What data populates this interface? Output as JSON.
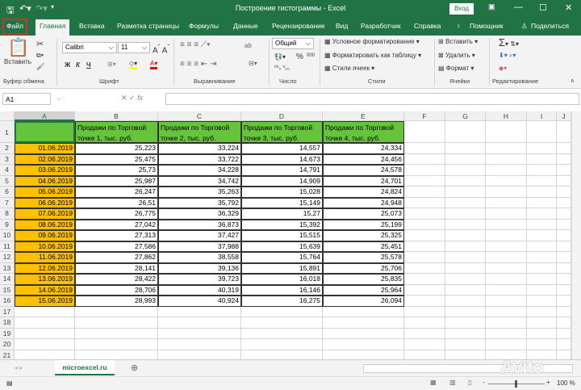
{
  "title": "Построение гистограммы  -  Excel",
  "login": "Вход",
  "tabs": [
    "Файл",
    "Главная",
    "Вставка",
    "Разметка страницы",
    "Формулы",
    "Данные",
    "Рецензирование",
    "Вид",
    "Разработчик",
    "Справка",
    "Помощник",
    "Поделиться"
  ],
  "ribbon": {
    "paste": "Вставить",
    "font_name": "Calibri",
    "font_size": "11",
    "bold": "Ж",
    "italic": "К",
    "underline": "Ч",
    "number_format": "Общий",
    "percent": "%",
    "thousands": "000",
    "cond_format": "Условное форматирование",
    "format_table": "Форматировать как таблицу",
    "cell_styles": "Стили ячеек",
    "insert": "Вставить",
    "delete": "Удалить",
    "format": "Формат",
    "groups": [
      "Буфер обмена",
      "Шрифт",
      "Выравнивание",
      "Число",
      "Стили",
      "Ячейки",
      "Редактирование"
    ]
  },
  "name_box": "A1",
  "columns": [
    "A",
    "B",
    "C",
    "D",
    "E",
    "F",
    "G",
    "H",
    "I",
    "J"
  ],
  "headers": [
    "Продажи по Торговой точке 1, тыс. руб.",
    "Продажи по Торговой точке 2, тыс. руб.",
    "Продажи по Торговой точке 3, тыс. руб.",
    "Продажи по Торговой точке 4, тыс. руб."
  ],
  "rows": [
    [
      "01.06.2019",
      "25,223",
      "33,224",
      "14,557",
      "24,334"
    ],
    [
      "02.06.2019",
      "25,475",
      "33,722",
      "14,673",
      "24,456"
    ],
    [
      "03.06.2019",
      "25,73",
      "34,228",
      "14,791",
      "24,578"
    ],
    [
      "04.06.2019",
      "25,987",
      "34,742",
      "14,909",
      "24,701"
    ],
    [
      "05.06.2019",
      "26,247",
      "35,263",
      "15,028",
      "24,824"
    ],
    [
      "06.06.2019",
      "26,51",
      "35,792",
      "15,149",
      "24,948"
    ],
    [
      "07.06.2019",
      "26,775",
      "36,329",
      "15,27",
      "25,073"
    ],
    [
      "08.06.2019",
      "27,042",
      "36,873",
      "15,392",
      "25,199"
    ],
    [
      "09.06.2019",
      "27,313",
      "37,427",
      "15,515",
      "25,325"
    ],
    [
      "10.06.2019",
      "27,586",
      "37,988",
      "15,639",
      "25,451"
    ],
    [
      "11.06.2019",
      "27,862",
      "38,558",
      "15,764",
      "25,578"
    ],
    [
      "12.06.2019",
      "28,141",
      "39,136",
      "15,891",
      "25,706"
    ],
    [
      "13.06.2019",
      "28,422",
      "39,723",
      "16,018",
      "25,835"
    ],
    [
      "14.06.2019",
      "28,706",
      "40,319",
      "16,146",
      "25,964"
    ],
    [
      "15.06.2019",
      "28,993",
      "40,924",
      "16,275",
      "26,094"
    ]
  ],
  "row_count": 21,
  "sheet_tab": "microexcel.ru",
  "zoom": "100 %",
  "watermark": "Avito"
}
